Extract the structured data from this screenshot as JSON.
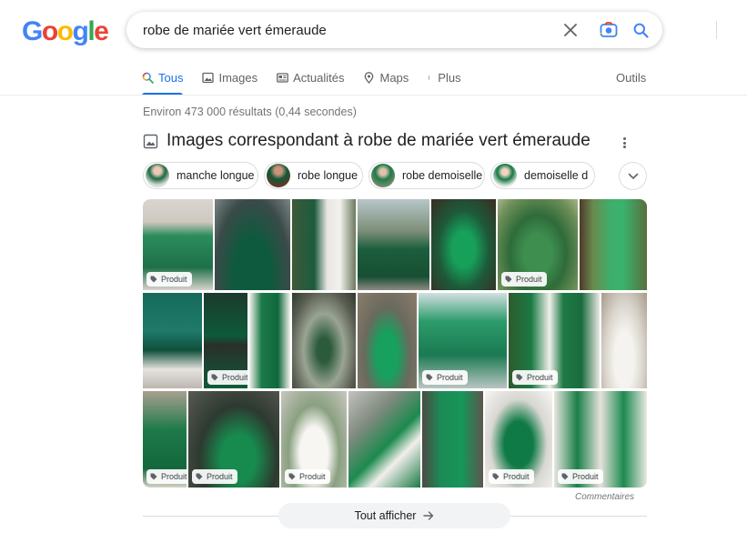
{
  "logo": {
    "letters": [
      "G",
      "o",
      "o",
      "g",
      "l",
      "e"
    ],
    "colors": [
      "#4285F4",
      "#EA4335",
      "#FBBC05",
      "#4285F4",
      "#34A853",
      "#EA4335"
    ]
  },
  "search": {
    "query": "robe de mariée vert émeraude",
    "icons": [
      "clear-icon",
      "camera-lens-icon",
      "search-icon"
    ]
  },
  "tabs": [
    {
      "label": "Tous",
      "icon": "search-icon",
      "active": true
    },
    {
      "label": "Images",
      "icon": "image-icon",
      "active": false
    },
    {
      "label": "Actualités",
      "icon": "news-icon",
      "active": false
    },
    {
      "label": "Maps",
      "icon": "map-pin-icon",
      "active": false
    },
    {
      "label": "Plus",
      "icon": "more-vert-icon",
      "active": false
    }
  ],
  "tools_label": "Outils",
  "result_stats": "Environ 473 000 résultats (0,44 secondes)",
  "images_section": {
    "title": "Images correspondant à robe de mariée vert émeraude",
    "chips": [
      {
        "label": "manche longue"
      },
      {
        "label": "robe longue"
      },
      {
        "label": "robe demoiselle"
      },
      {
        "label": "demoiselle d"
      }
    ],
    "badge_label": "Produit",
    "feedback_label": "Commentaires",
    "view_all_label": "Tout afficher"
  },
  "colors": {
    "accent": "#1a73e8",
    "emerald": "#0f6b3a",
    "text_secondary": "#70757a"
  }
}
